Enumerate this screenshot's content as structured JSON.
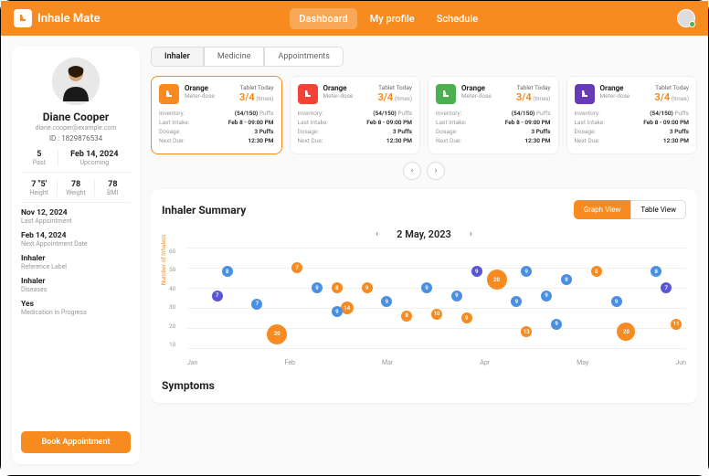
{
  "app": {
    "name": "Inhale Mate"
  },
  "nav": {
    "dashboard": "Dashboard",
    "profile": "My profile",
    "schedule": "Schedule"
  },
  "user": {
    "name": "Diane Cooper",
    "email": "diane.cooper@example.com",
    "id_label": "ID :",
    "id": "1829876534",
    "past_val": "5",
    "past_lbl": "Past",
    "upcoming_val": "Feb 14, 2024",
    "upcoming_lbl": "Upcoming",
    "height_val": "7 \"5'",
    "height_lbl": "Height",
    "weight_val": "78",
    "weight_lbl": "Weight",
    "bmi_val": "78",
    "bmi_lbl": "BMI"
  },
  "info": [
    {
      "val": "Nov 12, 2024",
      "lbl": "Last Appointment"
    },
    {
      "val": "Feb 14, 2024",
      "lbl": "Next Appointment Date"
    },
    {
      "val": "Inhaler",
      "lbl": "Reference Label"
    },
    {
      "val": "Inhaler",
      "lbl": "Diseases"
    },
    {
      "val": "Yes",
      "lbl": "Medication in Progress"
    }
  ],
  "book_btn": "Book Appointment",
  "tabs": {
    "inhaler": "Inhaler",
    "medicine": "Medicine",
    "appointments": "Appointments"
  },
  "card_common": {
    "title": "Orange",
    "sub": "Meter-dose",
    "tablet": "Tablet Today",
    "frac": "3/4",
    "times": "(times)",
    "inv_k": "Inventory:",
    "inv_v": "(54/150)",
    "inv_u": "Puffs",
    "last_k": "Last Intake:",
    "last_v": "Feb 8 - 09:00 PM",
    "dose_k": "Dosage:",
    "dose_v": "3 Puffs",
    "due_k": "Next Due:",
    "due_v": "12:30 PM"
  },
  "summary": {
    "title": "Inhaler Summary",
    "graph": "Graph View",
    "table": "Table View",
    "date": "2 May, 2023",
    "ylabel": "Number of Inhalers"
  },
  "symptoms_title": "Symptoms",
  "chart_data": {
    "type": "scatter",
    "xlabel": "",
    "ylabel": "Number of Inhalers",
    "x_categories": [
      "Jan",
      "Feb",
      "Mar",
      "Apr",
      "May",
      "Jun"
    ],
    "ylim": [
      10,
      60
    ],
    "y_ticks": [
      10,
      20,
      30,
      40,
      50,
      60
    ],
    "series": [
      {
        "name": "orange",
        "color": "#f78b1f",
        "points": [
          {
            "x": 0.22,
            "y": 50,
            "v": 7,
            "s": 12
          },
          {
            "x": 0.18,
            "y": 17,
            "v": 20,
            "s": 22
          },
          {
            "x": 0.32,
            "y": 30,
            "v": 14,
            "s": 14
          },
          {
            "x": 0.3,
            "y": 40,
            "v": 8,
            "s": 12
          },
          {
            "x": 0.36,
            "y": 40,
            "v": 9,
            "s": 12
          },
          {
            "x": 0.44,
            "y": 26,
            "v": 8,
            "s": 12
          },
          {
            "x": 0.5,
            "y": 27,
            "v": 10,
            "s": 12
          },
          {
            "x": 0.56,
            "y": 25,
            "v": 9,
            "s": 12
          },
          {
            "x": 0.62,
            "y": 44,
            "v": 20,
            "s": 22
          },
          {
            "x": 0.68,
            "y": 18,
            "v": 13,
            "s": 12
          },
          {
            "x": 0.82,
            "y": 48,
            "v": 8,
            "s": 12
          },
          {
            "x": 0.88,
            "y": 18,
            "v": 20,
            "s": 20
          },
          {
            "x": 0.98,
            "y": 22,
            "v": 11,
            "s": 12
          }
        ]
      },
      {
        "name": "blue",
        "color": "#4a90e2",
        "points": [
          {
            "x": 0.08,
            "y": 48,
            "v": 8,
            "s": 12
          },
          {
            "x": 0.14,
            "y": 32,
            "v": 7,
            "s": 12
          },
          {
            "x": 0.26,
            "y": 40,
            "v": 9,
            "s": 12
          },
          {
            "x": 0.3,
            "y": 28,
            "v": 9,
            "s": 12
          },
          {
            "x": 0.4,
            "y": 33,
            "v": 9,
            "s": 12
          },
          {
            "x": 0.48,
            "y": 40,
            "v": 9,
            "s": 12
          },
          {
            "x": 0.54,
            "y": 36,
            "v": 9,
            "s": 12
          },
          {
            "x": 0.66,
            "y": 33,
            "v": 9,
            "s": 12
          },
          {
            "x": 0.68,
            "y": 48,
            "v": 9,
            "s": 12
          },
          {
            "x": 0.72,
            "y": 36,
            "v": 9,
            "s": 12
          },
          {
            "x": 0.76,
            "y": 44,
            "v": 9,
            "s": 12
          },
          {
            "x": 0.74,
            "y": 22,
            "v": 9,
            "s": 12
          },
          {
            "x": 0.86,
            "y": 33,
            "v": 9,
            "s": 12
          },
          {
            "x": 0.94,
            "y": 48,
            "v": 8,
            "s": 12
          }
        ]
      },
      {
        "name": "purple",
        "color": "#5856d6",
        "points": [
          {
            "x": 0.06,
            "y": 36,
            "v": 7,
            "s": 12
          },
          {
            "x": 0.58,
            "y": 48,
            "v": 9,
            "s": 12
          },
          {
            "x": 0.96,
            "y": 40,
            "v": 7,
            "s": 12
          }
        ]
      }
    ]
  }
}
